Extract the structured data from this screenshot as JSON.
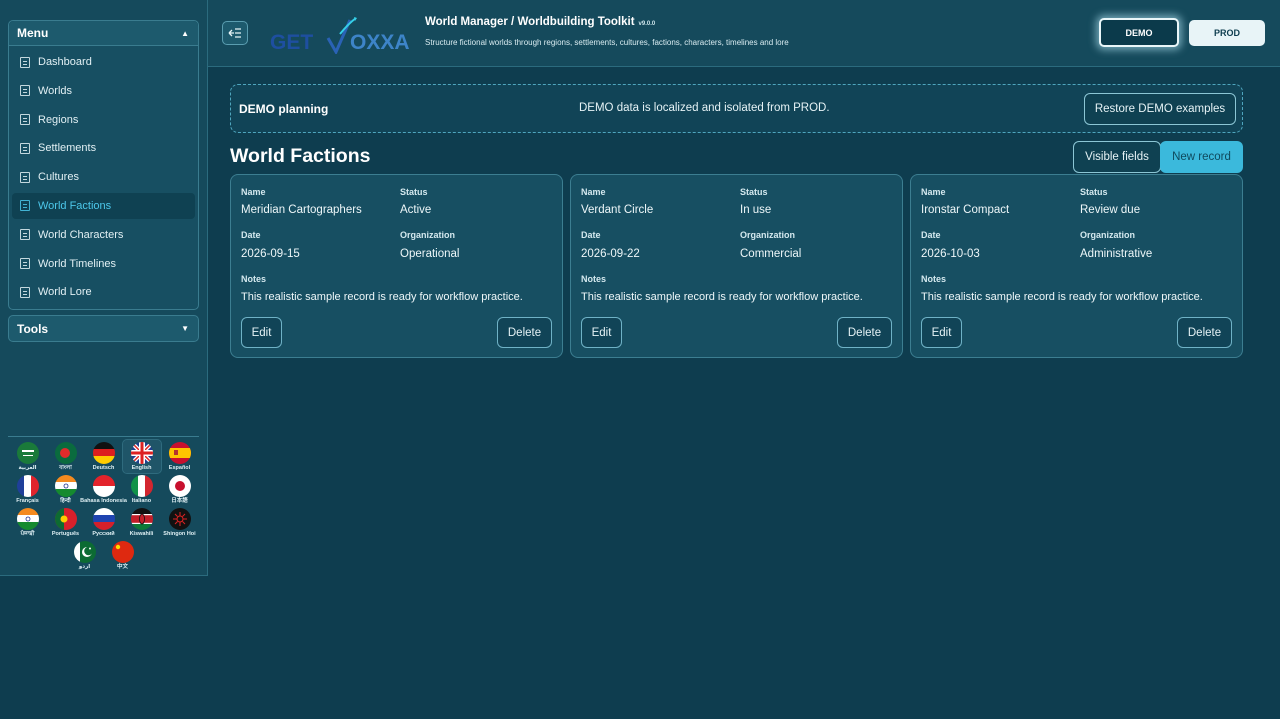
{
  "sidebar": {
    "menu_title": "Menu",
    "items": [
      {
        "label": "Dashboard"
      },
      {
        "label": "Worlds"
      },
      {
        "label": "Regions"
      },
      {
        "label": "Settlements"
      },
      {
        "label": "Cultures"
      },
      {
        "label": "World Factions",
        "active": true
      },
      {
        "label": "World Characters"
      },
      {
        "label": "World Timelines"
      },
      {
        "label": "World Lore"
      }
    ],
    "tools_title": "Tools",
    "languages": [
      {
        "name": "العربية",
        "flag": "sa"
      },
      {
        "name": "বাংলা",
        "flag": "bd"
      },
      {
        "name": "Deutsch",
        "flag": "de"
      },
      {
        "name": "English",
        "flag": "gb",
        "selected": true
      },
      {
        "name": "Español",
        "flag": "es"
      },
      {
        "name": "Français",
        "flag": "fr"
      },
      {
        "name": "हिन्दी",
        "flag": "in"
      },
      {
        "name": "Bahasa Indonesia",
        "flag": "id"
      },
      {
        "name": "Italiano",
        "flag": "it"
      },
      {
        "name": "日本語",
        "flag": "jp"
      },
      {
        "name": "ਪੰਜਾਬੀ",
        "flag": "in"
      },
      {
        "name": "Português",
        "flag": "pt"
      },
      {
        "name": "Русский",
        "flag": "ru"
      },
      {
        "name": "Kiswahili",
        "flag": "ke"
      },
      {
        "name": "Shingon Hoi",
        "flag": "sh"
      },
      {
        "name": "اردو",
        "flag": "pk"
      },
      {
        "name": "中文",
        "flag": "cn"
      }
    ]
  },
  "header": {
    "logo_text": "GETVOXXA",
    "title": "World Manager / Worldbuilding Toolkit",
    "version": "v9.0.0",
    "subtitle": "Structure fictional worlds through regions, settlements, cultures, factions, characters, timelines and lore",
    "env_demo": "DEMO",
    "env_prod": "PROD"
  },
  "banner": {
    "title": "DEMO planning",
    "message": "DEMO data is localized and isolated from PROD.",
    "restore_label": "Restore DEMO examples"
  },
  "page": {
    "title": "World Factions",
    "visible_fields_label": "Visible fields",
    "new_record_label": "New record"
  },
  "field_labels": {
    "name": "Name",
    "status": "Status",
    "date": "Date",
    "organization": "Organization",
    "notes": "Notes",
    "edit": "Edit",
    "delete": "Delete"
  },
  "records": [
    {
      "name": "Meridian Cartographers",
      "status": "Active",
      "date": "2026-09-15",
      "organization": "Operational",
      "notes": "This realistic sample record is ready for workflow practice."
    },
    {
      "name": "Verdant Circle",
      "status": "In use",
      "date": "2026-09-22",
      "organization": "Commercial",
      "notes": "This realistic sample record is ready for workflow practice."
    },
    {
      "name": "Ironstar Compact",
      "status": "Review due",
      "date": "2026-10-03",
      "organization": "Administrative",
      "notes": "This realistic sample record is ready for workflow practice."
    }
  ],
  "colors": {
    "background": "#0e3d4f",
    "panel": "#154a5c",
    "accent": "#3bb9dc",
    "active_text": "#4cc7ea"
  }
}
